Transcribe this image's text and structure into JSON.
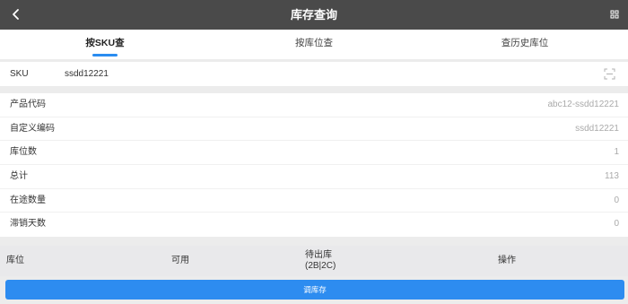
{
  "header": {
    "title": "库存查询",
    "back_icon": "chevron-left-icon",
    "scan_icon": "scan-icon"
  },
  "tabs": [
    {
      "label": "按SKU查",
      "active": true
    },
    {
      "label": "按库位查",
      "active": false
    },
    {
      "label": "查历史库位",
      "active": false
    }
  ],
  "sku": {
    "label": "SKU",
    "value": "ssdd12221",
    "scan_icon": "scan-frame-icon"
  },
  "info": [
    {
      "label": "产品代码",
      "value": "abc12-ssdd12221"
    },
    {
      "label": "自定义编码",
      "value": "ssdd12221"
    },
    {
      "label": "库位数",
      "value": "1"
    },
    {
      "label": "总计",
      "value": "113"
    },
    {
      "label": "在途数量",
      "value": "0"
    },
    {
      "label": "滞销天数",
      "value": "0"
    }
  ],
  "table": {
    "columns": [
      "库位",
      "可用",
      "待出库",
      "(2B|2C)",
      "操作"
    ]
  },
  "actions": {
    "adjust_label": "调库存"
  },
  "colors": {
    "header_bg": "#4a4a4a",
    "accent": "#2d8cf0"
  }
}
